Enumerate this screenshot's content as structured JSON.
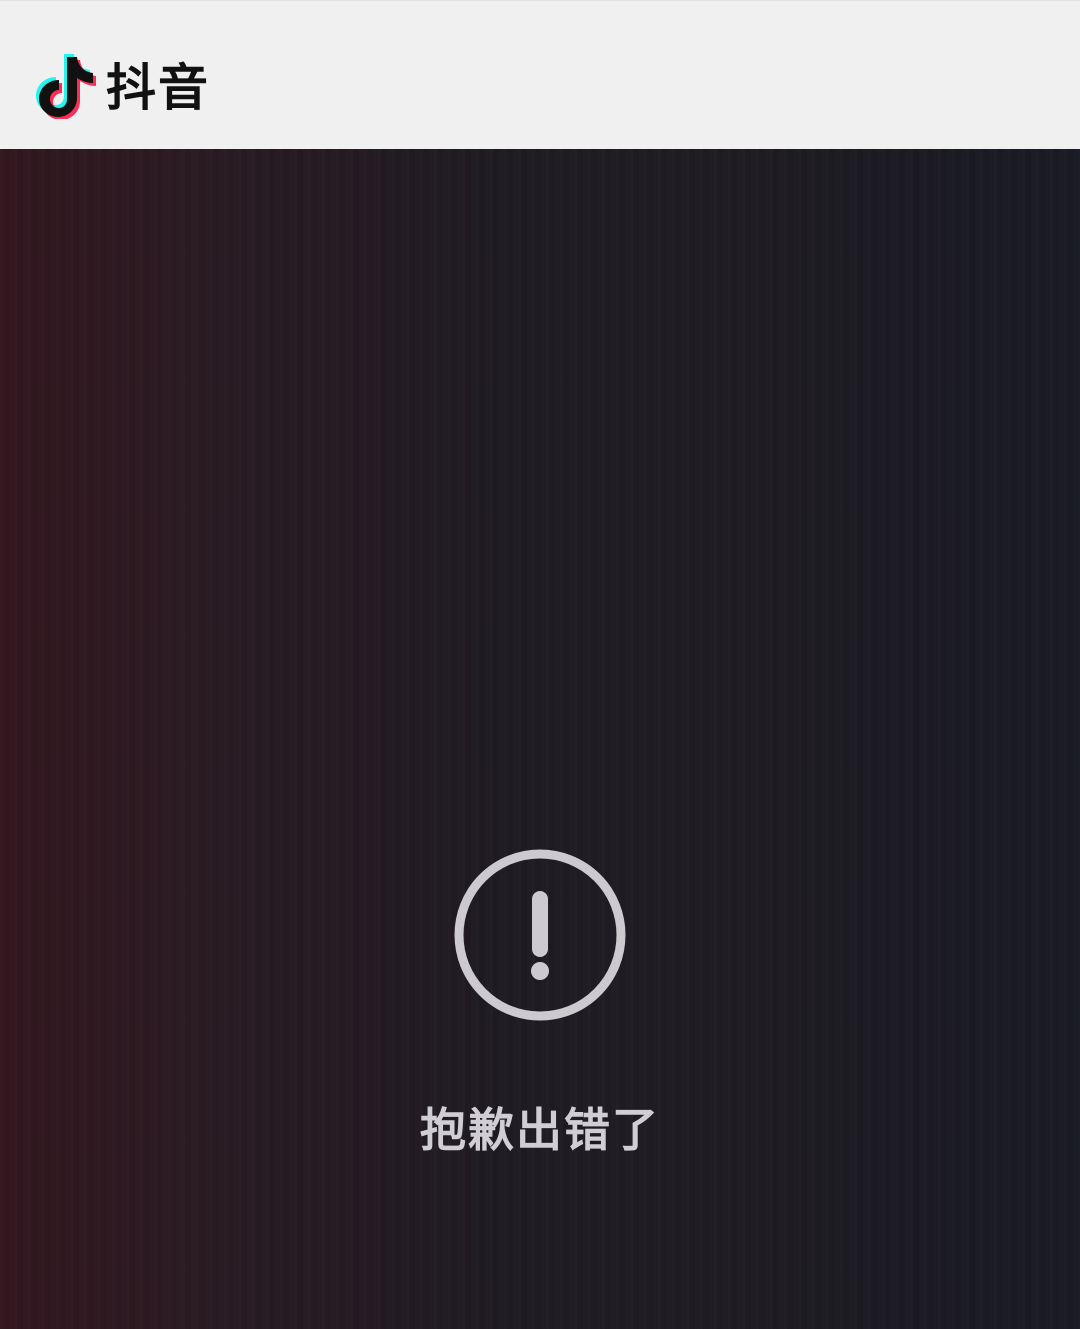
{
  "header": {
    "logo_icon": "douyin-note-icon",
    "brand_name": "抖音",
    "background": "#f0f0f0"
  },
  "main": {
    "error_icon": "exclamation-circle-icon",
    "error_message": "抱歉出错了",
    "icon_color": "#cdcacf",
    "text_color": "#d0ced3",
    "accent_red": "#fe2c55",
    "accent_cyan": "#25f4ee"
  }
}
